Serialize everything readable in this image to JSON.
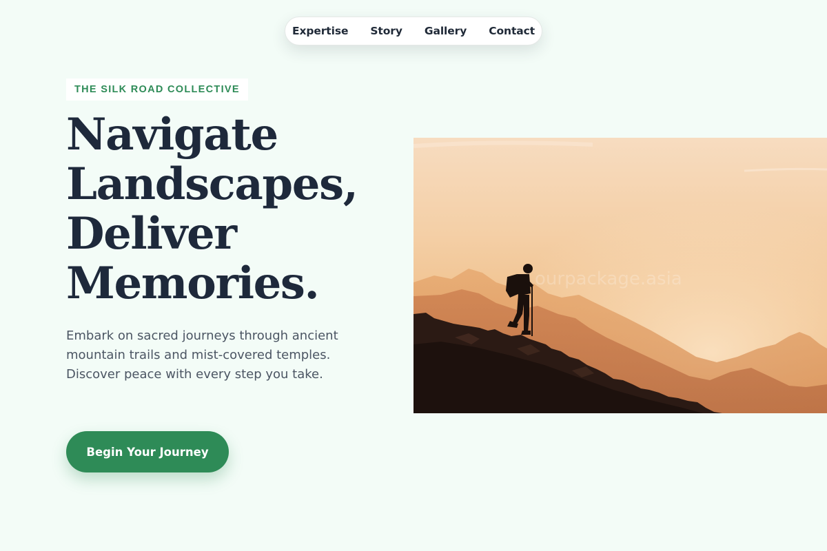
{
  "nav": {
    "items": [
      {
        "label": "Expertise"
      },
      {
        "label": "Story"
      },
      {
        "label": "Gallery"
      },
      {
        "label": "Contact"
      }
    ]
  },
  "hero": {
    "tag": "THE SILK ROAD COLLECTIVE",
    "headline": [
      "Navigate",
      "Landscapes,",
      "Deliver",
      "Memories."
    ],
    "description": "Embark on sacred journeys through ancient mountain trails and mist-covered temples. Discover peace with every step you take.",
    "cta_label": "Begin Your Journey"
  },
  "image": {
    "subject": "hiker silhouette on mountain ridge at sunset",
    "watermark": "ourpackage.asia"
  },
  "colors": {
    "background": "#f3fcf7",
    "accent": "#2e8b57",
    "heading": "#1e293b",
    "body_text": "#4b5563"
  }
}
